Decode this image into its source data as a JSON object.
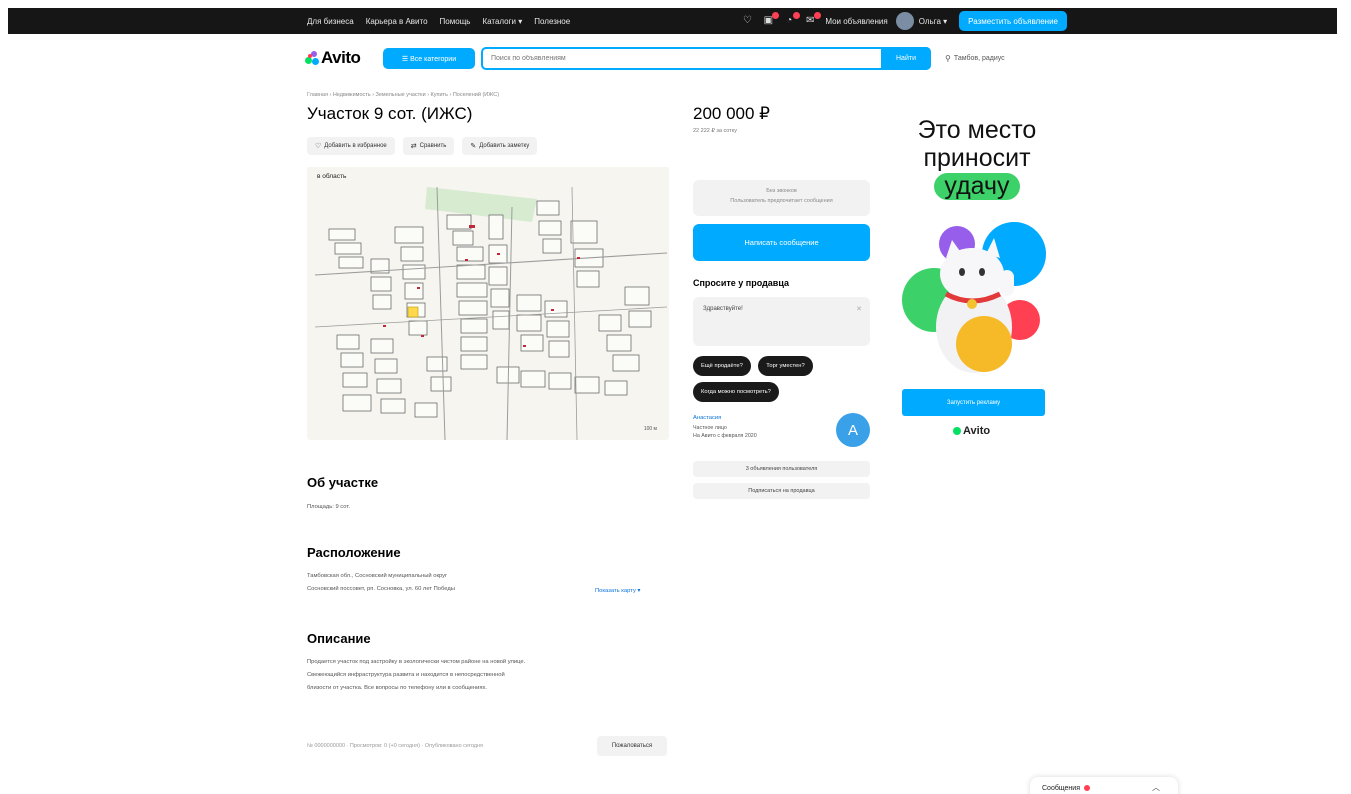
{
  "topbar": {
    "links": [
      "Для бизнеса",
      "Карьера в Авито",
      "Помощь",
      "Каталоги ▾",
      "Полезное"
    ],
    "ads_label": "Мои объявления",
    "user_name": "Ольга ▾",
    "post_ad": "Разместить объявление"
  },
  "header": {
    "logo": "Avito",
    "categories_button": "☰ Все категории",
    "search_placeholder": "Поиск по объявлениям",
    "search_button": "Найти",
    "location": "Тамбов, радиус"
  },
  "listing": {
    "breadcrumb": "Главная › Недвижимость › Земельные участки › Купить › Поселений (ИЖС)",
    "title": "Участок 9 сот. (ИЖС)",
    "actions": [
      {
        "icon": "heart-icon",
        "glyph": "♡",
        "label": "Добавить в избранное"
      },
      {
        "icon": "compare-icon",
        "glyph": "⇄",
        "label": "Сравнить"
      },
      {
        "icon": "note-icon",
        "glyph": "✎",
        "label": "Добавить заметку"
      }
    ],
    "map_label": "в область",
    "map_scale": "100 м",
    "about_title": "Об участке",
    "about_area": "Площадь: 9 сот.",
    "location_title": "Расположение",
    "address_line1": "Тамбовская обл., Сосновский муниципальный округ",
    "address_line2": "Сосновский поссовет, рп. Сосновка, ул. 60 лет Победы",
    "show_map": "Показать карту ▾",
    "description_title": "Описание",
    "description_lines": [
      "Продается участок под застройку в экологически чистом районе на новой улице.",
      "Свежеющийся инфраструктура развита и находится в непосредственной",
      "близости от участка. Все вопросы по телефону или в сообщениях."
    ],
    "footer_meta": "№ 0000000000 · Просмотров: 0 (+0 сегодня) · Опубликовано сегодня",
    "complaint_button": "Пожаловаться"
  },
  "sidebar": {
    "price": "200 000 ₽",
    "price_sub": "22 222 ₽ за сотку",
    "phone_line1": "Без звонков",
    "phone_line2": "Пользователь предпочитает сообщения",
    "write_button": "Написать сообщение",
    "ask_title": "Спросите у продавца",
    "ask_placeholder": "Здравствуйте!",
    "chips": [
      "Ещё продаёте?",
      "Торг уместен?",
      "Когда можно посмотреть?"
    ],
    "seller_name": "Анастасия",
    "seller_type": "Частное лицо",
    "seller_since": "На Авито с февраля 2020",
    "seller_initial": "А",
    "btn_other_ads": "3 объявления пользователя",
    "btn_subscribe": "Подписаться на продавца"
  },
  "ad": {
    "line1": "Это место",
    "line2": "приносит",
    "line3": "удачу",
    "button": "Запустить рекламу",
    "logo": "Avito"
  },
  "messenger": {
    "label": "Сообщения"
  },
  "colors": {
    "accent": "#00aaff",
    "topbar": "#161616",
    "badge": "#ff4053",
    "ad_green": "#3dd16a"
  }
}
